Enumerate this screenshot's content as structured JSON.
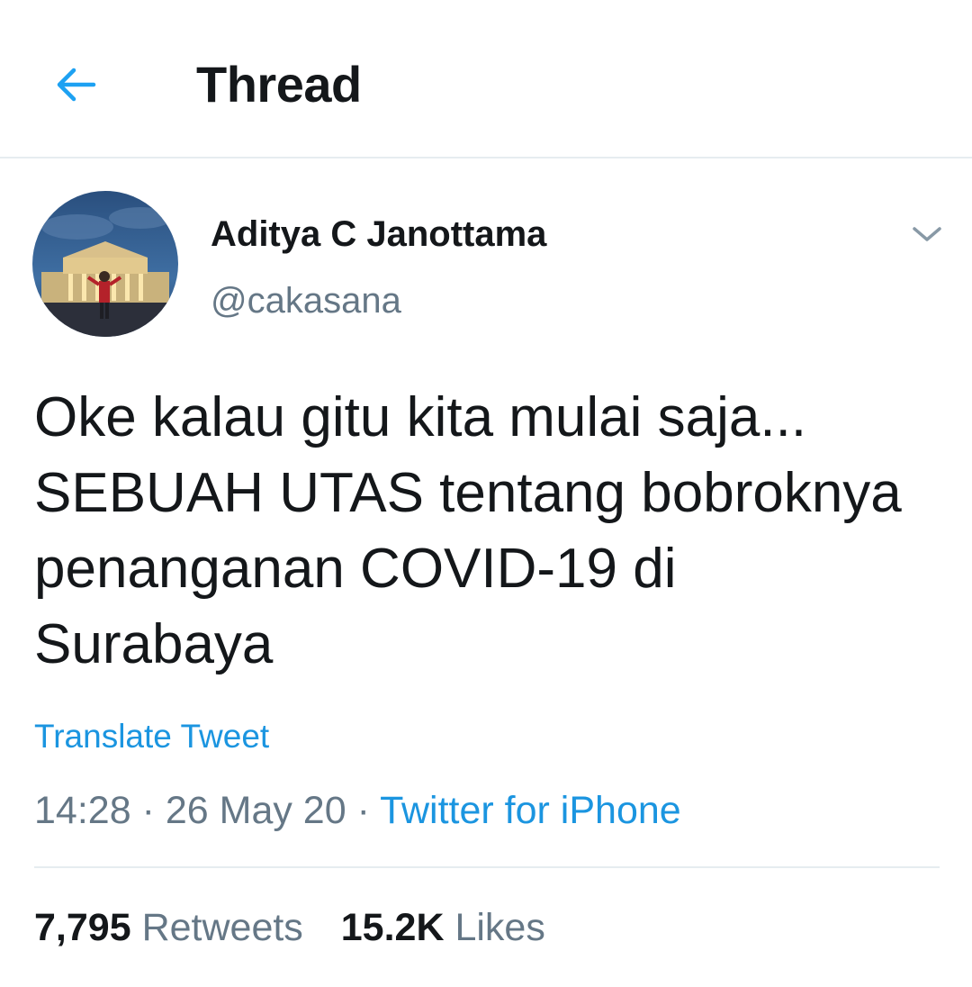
{
  "header": {
    "title": "Thread",
    "back_icon": "arrow-left-icon",
    "accent_color": "#1da1f2"
  },
  "tweet": {
    "author": {
      "display_name": "Aditya C Janottama",
      "handle": "@cakasana"
    },
    "menu_icon": "chevron-down-icon",
    "text_lines": [
      "Oke kalau gitu kita mulai saja...",
      "SEBUAH UTAS tentang bobroknya",
      "penanganan COVID-19 di",
      "Surabaya"
    ],
    "translate_label": "Translate Tweet",
    "time": "14:28",
    "separator": "·",
    "date": "26 May 20",
    "source": "Twitter for iPhone",
    "stats": {
      "retweets_count": "7,795",
      "retweets_label": "Retweets",
      "likes_count": "15.2K",
      "likes_label": "Likes"
    }
  },
  "colors": {
    "text_primary": "#14171a",
    "text_secondary": "#657786",
    "link": "#1b95e0",
    "divider": "#e6ecf0"
  }
}
